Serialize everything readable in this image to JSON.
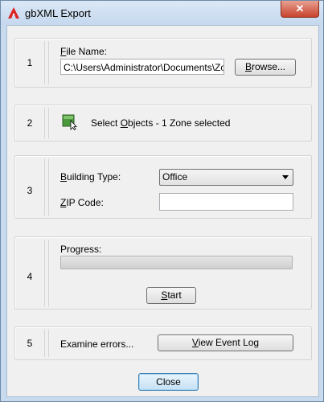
{
  "window": {
    "title": "gbXML Export",
    "close_glyph": "✕"
  },
  "sections": {
    "s1": {
      "number": "1",
      "file_label": "File Name:",
      "file_value": "C:\\Users\\Administrator\\Documents\\Zone",
      "browse_label": "Browse..."
    },
    "s2": {
      "number": "2",
      "select_label": "Select Objects - 1 Zone selected",
      "icon": "select-objects-icon"
    },
    "s3": {
      "number": "3",
      "building_type_label": "Building Type:",
      "building_type_value": "Office",
      "zip_label": "ZIP Code:",
      "zip_value": ""
    },
    "s4": {
      "number": "4",
      "progress_label": "Progress:",
      "progress_percent": 0,
      "start_label": "Start"
    },
    "s5": {
      "number": "5",
      "errors_label": "Examine errors...",
      "view_log_label": "View Event Log"
    }
  },
  "footer": {
    "close_label": "Close"
  },
  "colors": {
    "accent": "#3c7fb1",
    "close_red": "#c7432e",
    "icon_green": "#4a9a3c"
  }
}
